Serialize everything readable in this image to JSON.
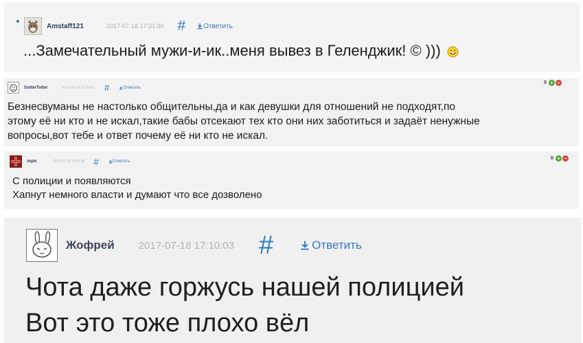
{
  "comments": [
    {
      "author": "Amstaff121",
      "date": "2017-07-18 17:31:36",
      "hash": "#",
      "reply": "Ответить",
      "lines": [
        "...Замечательный мужи-и-ик..меня вывез в Геленджик! © )))"
      ],
      "avatar_icon": "dog-avatar-icon"
    },
    {
      "author": "GotterTotter",
      "date": "2017-07-18 17:10:03",
      "hash": "#",
      "reply": "Ответить",
      "votes": "0",
      "lines": [
        "Безнесвуманы не настолько общительны,да и как девушки для отношений не подходят,по",
        "этому её ни кто и не искал,такие бабы отсекают тех кто они них заботиться и задаёт ненужные",
        "вопросы,вот тебе и ответ почему её ни кто не искал."
      ],
      "avatar_icon": "cartoon-avatar-icon"
    },
    {
      "author": "zepic",
      "date": "2017-07-18 22:01:39",
      "hash": "#",
      "reply": "Ответить",
      "votes": "0",
      "lines": [
        "С полиции и появляются",
        "Хапнут немного власти и думают что все дозволено"
      ],
      "avatar_icon": "cross-emblem-avatar-icon"
    },
    {
      "author": "Жофрей",
      "date": "2017-07-18 17:10:03",
      "hash": "#",
      "reply": "Ответить",
      "lines": [
        "Чота даже горжусь нашей полицией",
        "Вот это тоже плохо вёл"
      ],
      "avatar_icon": "bunny-avatar-icon"
    }
  ],
  "colors": {
    "link": "#3a78bf",
    "hash": "#2f7cc0",
    "date": "#b2b2b2",
    "plus": "#4aa832",
    "minus": "#d9473e"
  }
}
